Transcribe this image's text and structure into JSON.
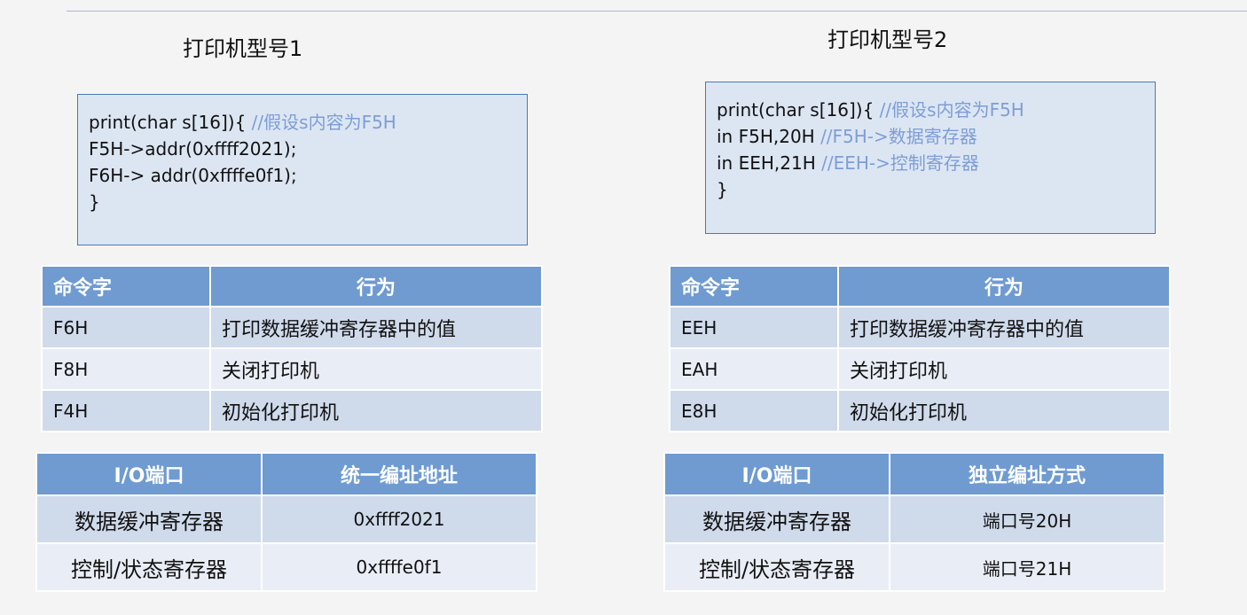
{
  "left": {
    "title": "打印机型号1",
    "code": [
      {
        "text": "print(char s[16]){ ",
        "comment": "//假设s内容为F5H"
      },
      {
        "text": "F5H->addr(0xffff2021);",
        "comment": ""
      },
      {
        "text": "F6H->  addr(0xffffe0f1);",
        "comment": ""
      },
      {
        "text": "}",
        "comment": ""
      }
    ],
    "cmd_table": {
      "headers": [
        "命令字",
        "行为"
      ],
      "rows": [
        [
          "F6H",
          "打印数据缓冲寄存器中的值"
        ],
        [
          "F8H",
          "关闭打印机"
        ],
        [
          "F4H",
          "初始化打印机"
        ]
      ]
    },
    "io_table": {
      "headers": [
        "I/O端口",
        "统一编址地址"
      ],
      "rows": [
        [
          "数据缓冲寄存器",
          "0xffff2021"
        ],
        [
          "控制/状态寄存器",
          "0xffffe0f1"
        ]
      ]
    }
  },
  "right": {
    "title": "打印机型号2",
    "code": [
      {
        "text": "print(char s[16]){  ",
        "comment": "//假设s内容为F5H"
      },
      {
        "text": "in F5H,20H ",
        "comment": "//F5H->数据寄存器"
      },
      {
        "text": "in EEH,21H ",
        "comment": "//EEH->控制寄存器"
      },
      {
        "text": "}",
        "comment": ""
      }
    ],
    "cmd_table": {
      "headers": [
        "命令字",
        "行为"
      ],
      "rows": [
        [
          "EEH",
          "打印数据缓冲寄存器中的值"
        ],
        [
          "EAH",
          "关闭打印机"
        ],
        [
          "E8H",
          "初始化打印机"
        ]
      ]
    },
    "io_table": {
      "headers": [
        "I/O端口",
        "独立编址方式"
      ],
      "rows": [
        [
          "数据缓冲寄存器",
          "端口号20H"
        ],
        [
          "控制/状态寄存器",
          "端口号21H"
        ]
      ]
    }
  }
}
